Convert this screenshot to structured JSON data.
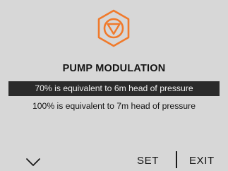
{
  "icon": {
    "name": "pump-icon",
    "color": "#f07a2b"
  },
  "title": "PUMP MODULATION",
  "options": [
    {
      "label": "70% is equivalent to 6m head of pressure",
      "selected": true
    },
    {
      "label": "100% is equivalent to 7m head of pressure",
      "selected": false
    }
  ],
  "footer": {
    "down_icon": "chevron-down-icon",
    "set_label": "SET",
    "exit_label": "EXIT"
  }
}
